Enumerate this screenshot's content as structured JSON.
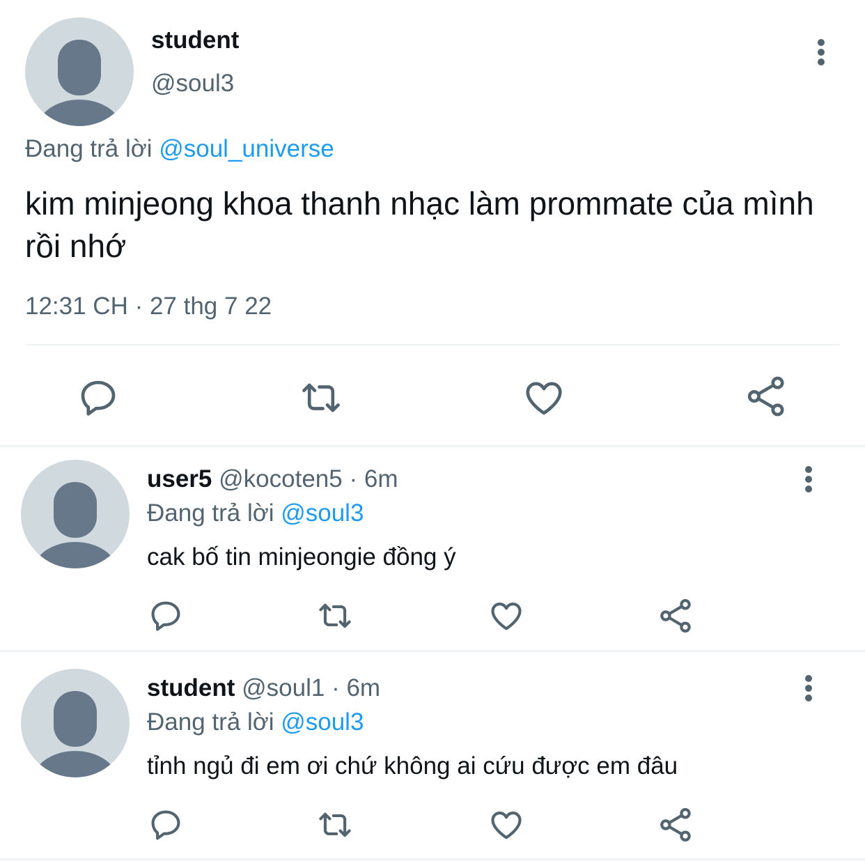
{
  "main_tweet": {
    "display_name": "student",
    "handle": "@soul3",
    "replying_prefix": "Đang trả lời",
    "replying_to": "@soul_universe",
    "text": "kim minjeong khoa thanh nhạc làm prommate của mình rồi nhớ",
    "timestamp": "12:31 CH · 27 thg 7 22"
  },
  "replies": [
    {
      "display_name": "user5",
      "handle": "@kocoten5",
      "time": "· 6m",
      "replying_prefix": "Đang trả lời",
      "replying_to": "@soul3",
      "text": "cak bố tin minjeongie đồng ý"
    },
    {
      "display_name": "student",
      "handle": "@soul1",
      "time": "· 6m",
      "replying_prefix": "Đang trả lời",
      "replying_to": "@soul3",
      "text": "tỉnh ngủ đi em ơi chứ không ai cứu được em đâu"
    }
  ],
  "icons": {
    "reply": "speech-bubble-icon",
    "retweet": "retweet-icon",
    "like": "heart-icon",
    "share": "share-icon",
    "more": "vertical-dots-icon",
    "avatar": "default-avatar-icon"
  },
  "colors": {
    "link": "#1d9bf0",
    "muted": "#536471",
    "text": "#0f1419",
    "avatar_bg": "#cfd9de",
    "avatar_fg": "#66788a"
  }
}
